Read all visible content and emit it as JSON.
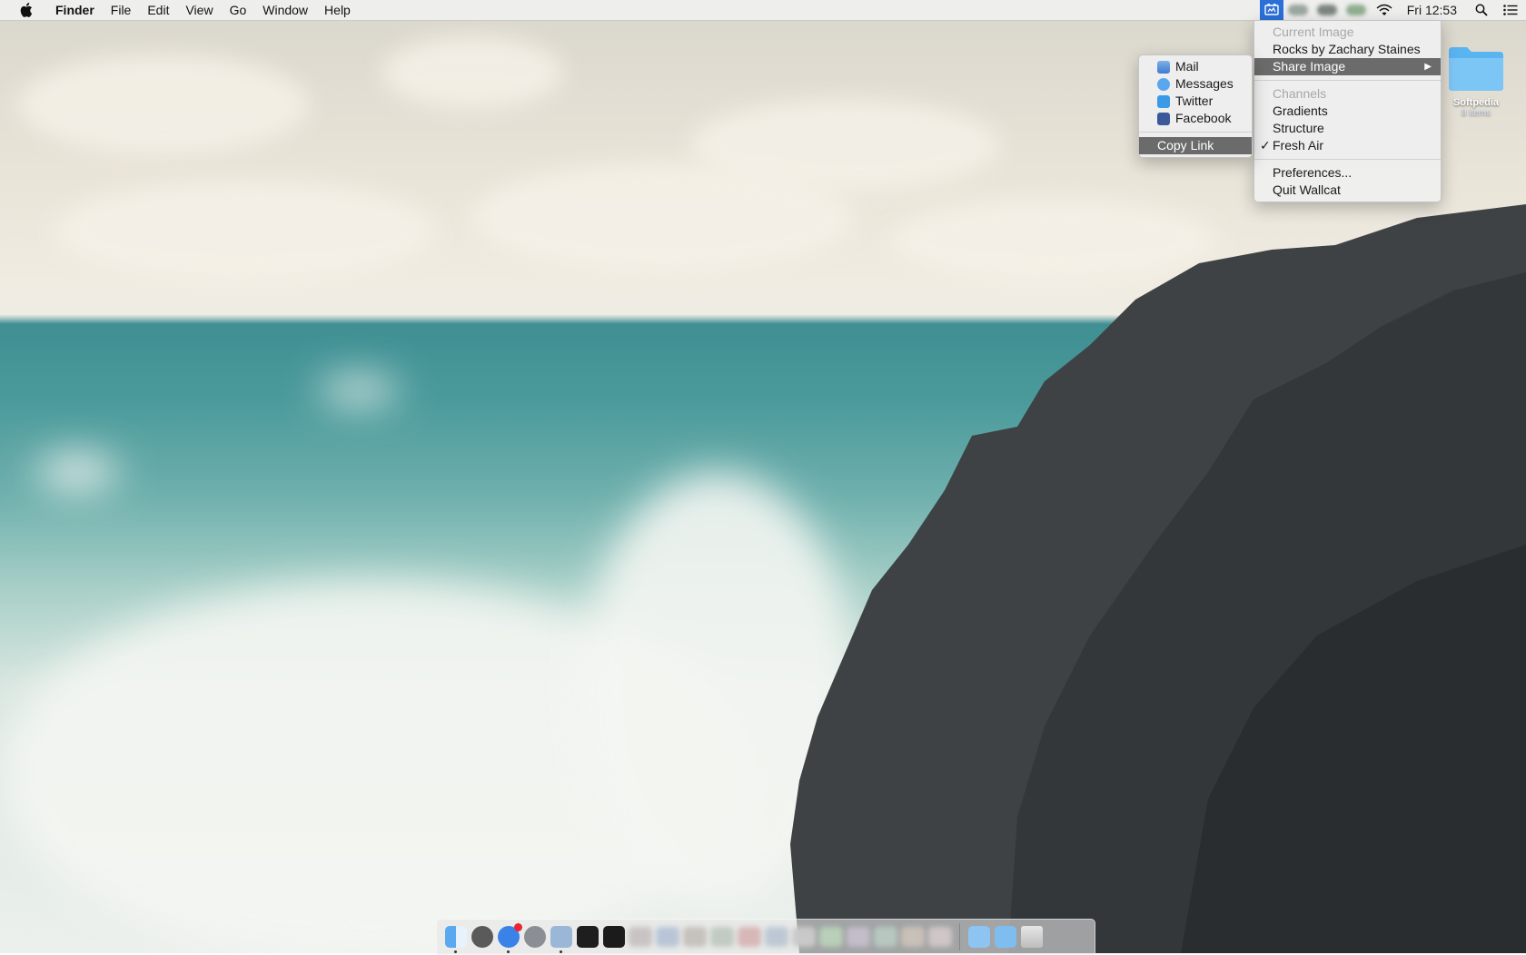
{
  "menubar": {
    "app_name": "Finder",
    "items": [
      "File",
      "Edit",
      "View",
      "Go",
      "Window",
      "Help"
    ],
    "clock": "Fri 12:53"
  },
  "wallcat_menu": {
    "current_image_header": "Current Image",
    "image_credit": "Rocks by Zachary Staines",
    "share_image": "Share Image",
    "channels_header": "Channels",
    "channels": [
      {
        "label": "Gradients",
        "checked": false
      },
      {
        "label": "Structure",
        "checked": false
      },
      {
        "label": "Fresh Air",
        "checked": true
      }
    ],
    "check_mark": "✓",
    "preferences": "Preferences...",
    "quit": "Quit Wallcat"
  },
  "share_submenu": {
    "items": [
      {
        "label": "Mail",
        "icon": "mail-icon"
      },
      {
        "label": "Messages",
        "icon": "messages-icon"
      },
      {
        "label": "Twitter",
        "icon": "twitter-icon"
      },
      {
        "label": "Facebook",
        "icon": "facebook-icon"
      }
    ],
    "copy_link": "Copy Link"
  },
  "desktop": {
    "folder_name": "Softpedia",
    "folder_count": "8 items"
  },
  "colors": {
    "highlight": "#6b6b6b",
    "menubar_bg": "#f0f0f0",
    "folder_blue": "#5ab4f0"
  }
}
